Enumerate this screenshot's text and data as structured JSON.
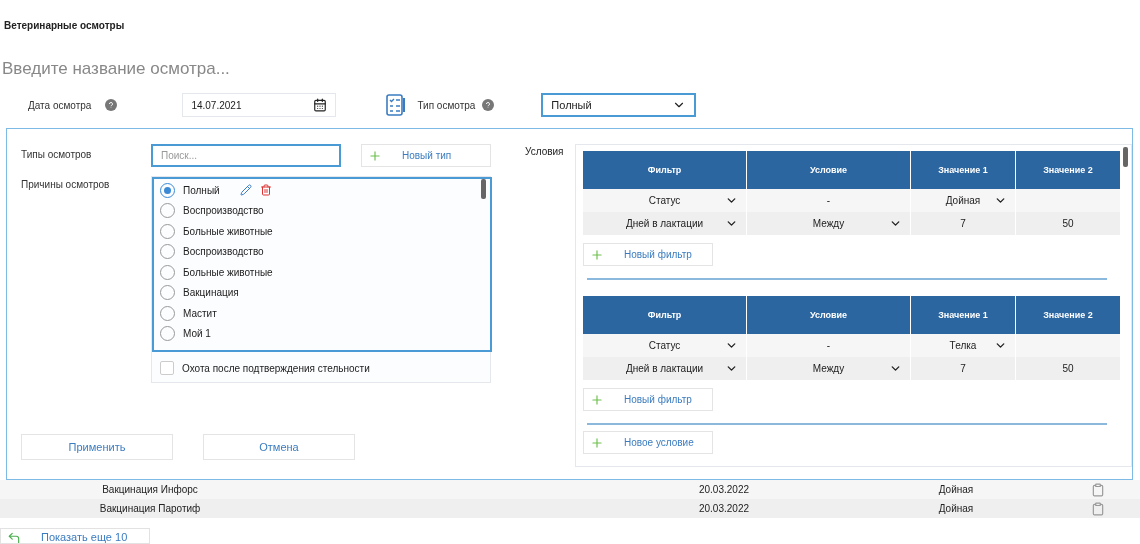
{
  "page_title": "Ветеринарные осмотры",
  "name_field": {
    "placeholder": "Введите название осмотра..."
  },
  "date": {
    "label": "Дата осмотра",
    "value": "14.07.2021"
  },
  "type": {
    "label": "Тип осмотра",
    "value": "Полный"
  },
  "modal": {
    "types_label": "Типы осмотров",
    "search": {
      "placeholder": "Поиск..."
    },
    "new_type": "Новый тип",
    "reasons_label": "Причины осмотров",
    "reasons": [
      {
        "kind": "radio",
        "label": "Полный",
        "selected": true
      },
      {
        "kind": "radio",
        "label": "Воспроизводство",
        "selected": false
      },
      {
        "kind": "radio",
        "label": "Больные животные",
        "selected": false
      },
      {
        "kind": "radio",
        "label": "Воспроизводство",
        "selected": false
      },
      {
        "kind": "radio",
        "label": "Больные животные",
        "selected": false
      },
      {
        "kind": "radio",
        "label": "Вакцинация",
        "selected": false
      },
      {
        "kind": "radio",
        "label": "Мастит",
        "selected": false
      },
      {
        "kind": "radio",
        "label": "Мой 1",
        "selected": false
      },
      {
        "kind": "checkbox",
        "label": "Охота после подтверждения стельности",
        "checked": false
      }
    ],
    "apply": "Применить",
    "cancel": "Отмена",
    "conditions_label": "Условия",
    "groups": [
      {
        "columns": [
          "Фильтр",
          "Условие",
          "Значение 1",
          "Значение 2"
        ],
        "rows": [
          [
            {
              "text": "Статус",
              "dropdown": true
            },
            {
              "text": "-",
              "dropdown": false
            },
            {
              "text": "Дойная",
              "dropdown": true
            },
            {
              "dropdown": false
            }
          ],
          [
            {
              "text": "Дней в лактации",
              "dropdown": true
            },
            {
              "text": "Между",
              "dropdown": true
            },
            {
              "text": "7",
              "dropdown": false
            },
            {
              "text": "50",
              "dropdown": false
            }
          ]
        ],
        "new_filter": "Новый фильтр"
      },
      {
        "columns": [
          "Фильтр",
          "Условие",
          "Значение 1",
          "Значение 2"
        ],
        "rows": [
          [
            {
              "text": "Статус",
              "dropdown": true
            },
            {
              "text": "-",
              "dropdown": false
            },
            {
              "text": "Телка",
              "dropdown": true
            },
            {
              "dropdown": false
            }
          ],
          [
            {
              "text": "Дней в лактации",
              "dropdown": true
            },
            {
              "text": "Между",
              "dropdown": true
            },
            {
              "text": "7",
              "dropdown": false
            },
            {
              "text": "50",
              "dropdown": false
            }
          ]
        ],
        "new_filter": "Новый фильтр"
      }
    ],
    "new_condition": "Новое условие"
  },
  "table_rows": [
    {
      "name": "Вакцинация Инфорс",
      "date": "20.03.2022",
      "status": "Дойная"
    },
    {
      "name": "Вакцинация Паротиф",
      "date": "20.03.2022",
      "status": "Дойная"
    }
  ],
  "show_more": "Показать еще 10"
}
